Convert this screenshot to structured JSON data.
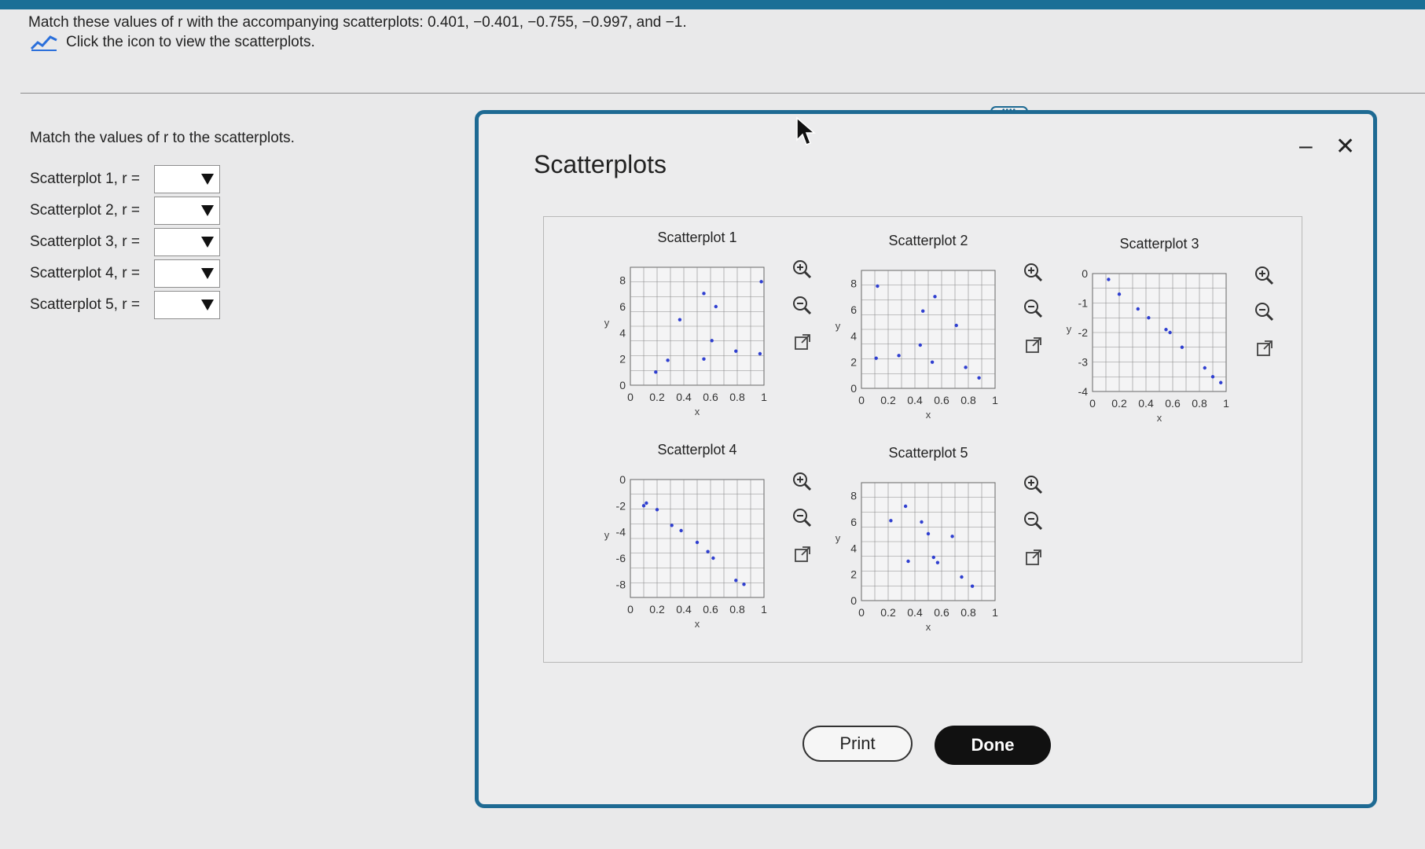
{
  "question": {
    "text": "Match these values of r with the accompanying scatterplots: 0.401, −0.401, −0.755, −0.997, and −1.",
    "link_label": "Click the icon to view the scatterplots."
  },
  "instruction": "Match the values of r to the scatterplots.",
  "match_rows": [
    {
      "label": "Scatterplot 1, r =",
      "value": ""
    },
    {
      "label": "Scatterplot 2, r =",
      "value": ""
    },
    {
      "label": "Scatterplot 3, r =",
      "value": ""
    },
    {
      "label": "Scatterplot 4, r =",
      "value": ""
    },
    {
      "label": "Scatterplot 5, r =",
      "value": ""
    }
  ],
  "modal": {
    "title": "Scatterplots",
    "minimize": "–",
    "close": "✕",
    "grip": "••••",
    "print_label": "Print",
    "done_label": "Done"
  },
  "colors": {
    "accent": "#1e6a93",
    "point": "#2f3fd0",
    "grid": "#8a8a8a"
  },
  "controls": [
    "zoom-in-icon",
    "zoom-out-icon",
    "external-link-icon"
  ],
  "chart_data": [
    {
      "type": "scatter",
      "title": "Scatterplot 1",
      "xlabel": "x",
      "ylabel": "y",
      "xlim": [
        0,
        1
      ],
      "ylim": [
        0,
        9
      ],
      "xticks": [
        "0",
        "0.2",
        "0.4",
        "0.6",
        "0.8",
        "1"
      ],
      "yticks": [
        "0",
        "2",
        "4",
        "6",
        "8"
      ],
      "points": [
        [
          0.19,
          1.0
        ],
        [
          0.28,
          1.9
        ],
        [
          0.37,
          5.0
        ],
        [
          0.55,
          2.0
        ],
        [
          0.55,
          7.0
        ],
        [
          0.61,
          3.4
        ],
        [
          0.64,
          6.0
        ],
        [
          0.79,
          2.6
        ],
        [
          0.97,
          2.4
        ],
        [
          0.98,
          7.9
        ]
      ]
    },
    {
      "type": "scatter",
      "title": "Scatterplot 2",
      "xlabel": "x",
      "ylabel": "y",
      "xlim": [
        0,
        1
      ],
      "ylim": [
        0,
        9
      ],
      "xticks": [
        "0",
        "0.2",
        "0.4",
        "0.6",
        "0.8",
        "1"
      ],
      "yticks": [
        "0",
        "2",
        "4",
        "6",
        "8"
      ],
      "points": [
        [
          0.11,
          2.3
        ],
        [
          0.12,
          7.8
        ],
        [
          0.28,
          2.5
        ],
        [
          0.44,
          3.3
        ],
        [
          0.46,
          5.9
        ],
        [
          0.53,
          2.0
        ],
        [
          0.55,
          7.0
        ],
        [
          0.71,
          4.8
        ],
        [
          0.78,
          1.6
        ],
        [
          0.88,
          0.8
        ]
      ]
    },
    {
      "type": "scatter",
      "title": "Scatterplot 3",
      "xlabel": "x",
      "ylabel": "y",
      "xlim": [
        0,
        1
      ],
      "ylim": [
        -4,
        0
      ],
      "xticks": [
        "0",
        "0.2",
        "0.4",
        "0.6",
        "0.8",
        "1"
      ],
      "yticks": [
        "0",
        "-1",
        "-2",
        "-3",
        "-4"
      ],
      "points": [
        [
          0.12,
          -0.2
        ],
        [
          0.2,
          -0.7
        ],
        [
          0.34,
          -1.2
        ],
        [
          0.42,
          -1.5
        ],
        [
          0.55,
          -1.9
        ],
        [
          0.58,
          -2.0
        ],
        [
          0.67,
          -2.5
        ],
        [
          0.84,
          -3.2
        ],
        [
          0.9,
          -3.5
        ],
        [
          0.96,
          -3.7
        ]
      ]
    },
    {
      "type": "scatter",
      "title": "Scatterplot 4",
      "xlabel": "x",
      "ylabel": "y",
      "xlim": [
        0,
        1
      ],
      "ylim": [
        -9,
        0
      ],
      "xticks": [
        "0",
        "0.2",
        "0.4",
        "0.6",
        "0.8",
        "1"
      ],
      "yticks": [
        "0",
        "-2",
        "-4",
        "-6",
        "-8"
      ],
      "points": [
        [
          0.1,
          -2.0
        ],
        [
          0.12,
          -1.8
        ],
        [
          0.2,
          -2.3
        ],
        [
          0.31,
          -3.5
        ],
        [
          0.38,
          -3.9
        ],
        [
          0.5,
          -4.8
        ],
        [
          0.58,
          -5.5
        ],
        [
          0.62,
          -6.0
        ],
        [
          0.79,
          -7.7
        ],
        [
          0.85,
          -8.0
        ]
      ]
    },
    {
      "type": "scatter",
      "title": "Scatterplot 5",
      "xlabel": "x",
      "ylabel": "y",
      "xlim": [
        0,
        1
      ],
      "ylim": [
        0,
        9
      ],
      "xticks": [
        "0",
        "0.2",
        "0.4",
        "0.6",
        "0.8",
        "1"
      ],
      "yticks": [
        "0",
        "2",
        "4",
        "6",
        "8"
      ],
      "points": [
        [
          0.22,
          6.1
        ],
        [
          0.33,
          7.2
        ],
        [
          0.35,
          3.0
        ],
        [
          0.45,
          6.0
        ],
        [
          0.5,
          5.1
        ],
        [
          0.54,
          3.3
        ],
        [
          0.57,
          2.9
        ],
        [
          0.68,
          4.9
        ],
        [
          0.75,
          1.8
        ],
        [
          0.83,
          1.1
        ]
      ]
    }
  ]
}
